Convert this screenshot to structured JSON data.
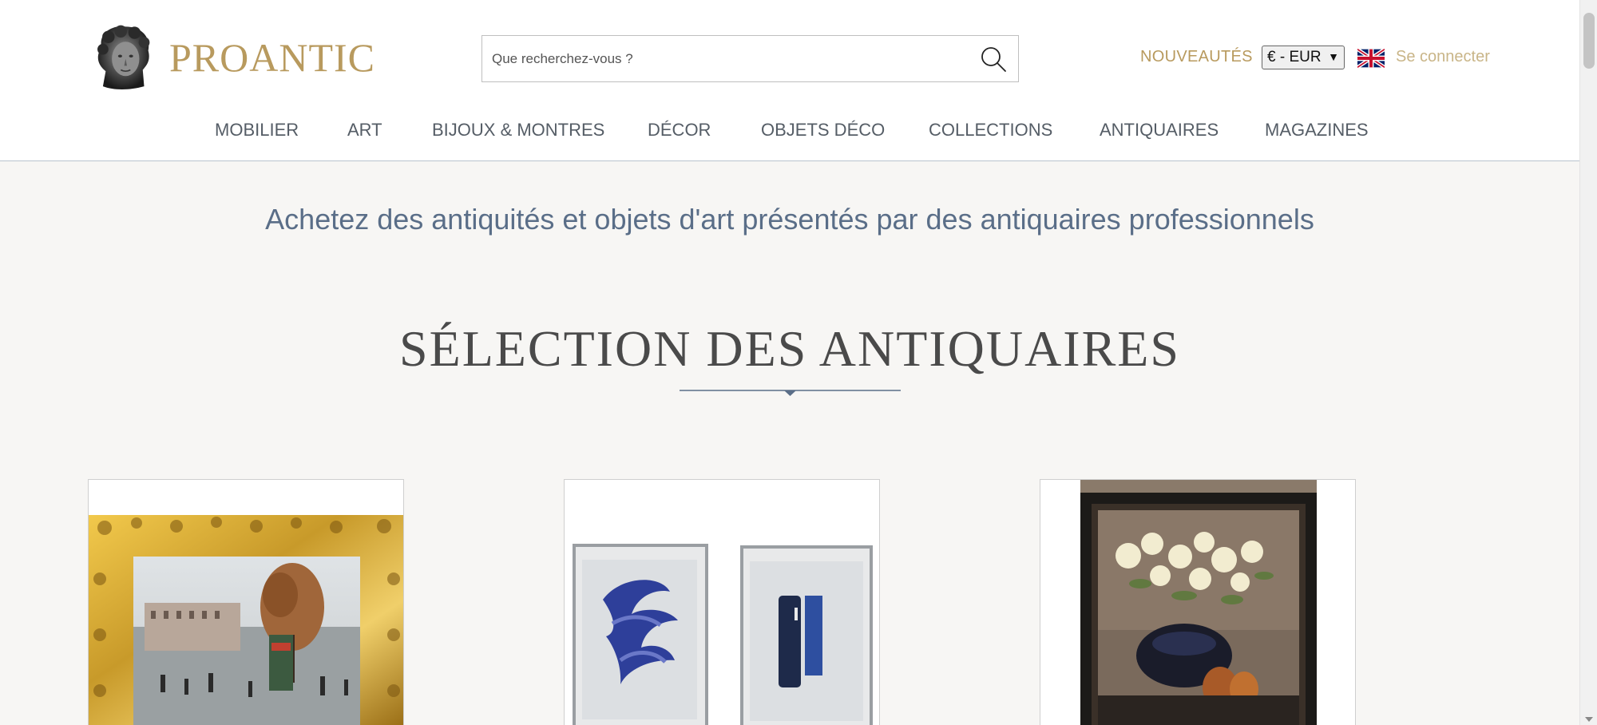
{
  "brand": {
    "name": "PROANTIC",
    "gold": "#b89a5e"
  },
  "search": {
    "placeholder": "Que recherchez-vous ?",
    "icon": "search-icon"
  },
  "header": {
    "nouveautes_label": "NOUVEAUTÉS",
    "currency_selected": "€ - EUR",
    "language_flag": "uk-flag-icon",
    "login_label": "Se connecter"
  },
  "nav": {
    "items": [
      {
        "label": "MOBILIER"
      },
      {
        "label": "ART"
      },
      {
        "label": "BIJOUX & MONTRES"
      },
      {
        "label": "DÉCOR"
      },
      {
        "label": "OBJETS DÉCO"
      },
      {
        "label": "COLLECTIONS"
      },
      {
        "label": "ANTIQUAIRES"
      },
      {
        "label": "MAGAZINES"
      }
    ]
  },
  "main": {
    "tagline": "Achetez des antiquités et objets d'art présentés par des antiquaires professionnels",
    "section_title": "SÉLECTION DES ANTIQUAIRES",
    "accent_color": "#5a6e88",
    "cards": [
      {
        "image": "gilded-frame-paris-street-painting"
      },
      {
        "image": "two-framed-blue-abstract-prints"
      },
      {
        "image": "framed-still-life-roses-painting"
      }
    ]
  }
}
